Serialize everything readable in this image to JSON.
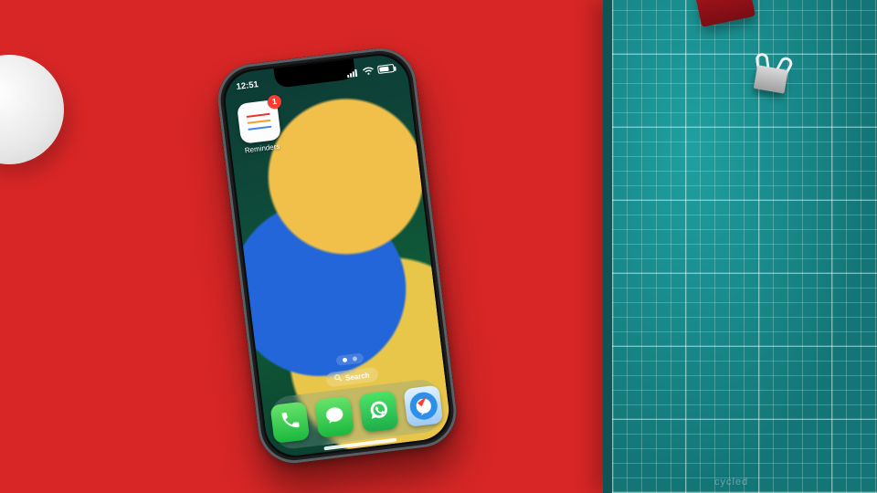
{
  "status_bar": {
    "time": "12:51"
  },
  "home_screen": {
    "reminders": {
      "label": "Reminders",
      "badge": "1"
    },
    "search_label": "Search"
  },
  "dock": {
    "phone": "Phone",
    "messages": "Messages",
    "whatsapp": "WhatsApp",
    "safari": "Safari"
  },
  "mat": {
    "brand": "cycled"
  }
}
